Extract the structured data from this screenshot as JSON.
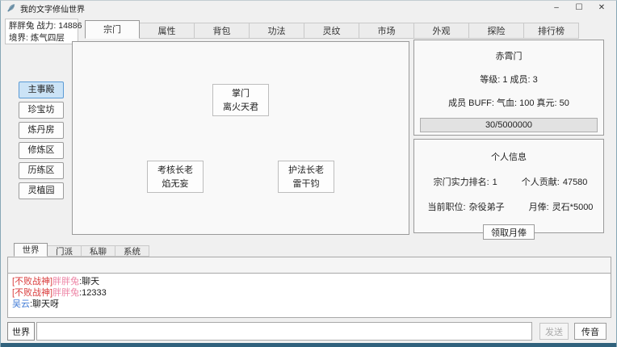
{
  "window": {
    "title": "我的文字修仙世界",
    "controls": {
      "minimize": "–",
      "maximize": "☐",
      "close": "✕"
    }
  },
  "player": {
    "line1": "胖胖兔 战力: 14886",
    "line2": "境界: 炼气四层"
  },
  "tabs": {
    "items": [
      "宗门",
      "属性",
      "背包",
      "功法",
      "灵纹",
      "市场",
      "外观",
      "探险",
      "排行榜"
    ],
    "active": "宗门"
  },
  "sidebar": {
    "items": [
      "主事殿",
      "珍宝坊",
      "炼丹房",
      "修炼区",
      "历练区",
      "灵植园"
    ],
    "active": "主事殿"
  },
  "sect_map": {
    "nodes": [
      {
        "title": "掌门",
        "name": "离火天君"
      },
      {
        "title": "考核长老",
        "name": "焰无妄"
      },
      {
        "title": "护法长老",
        "name": "雷干钧"
      }
    ]
  },
  "sect_panel": {
    "name": "赤霄门",
    "level_members": "等级: 1 成员: 3",
    "buff": "成员 BUFF:  气血: 100 真元: 50",
    "progress_text": "30/5000000"
  },
  "personal_panel": {
    "title": "个人信息",
    "rank_label": "宗门实力排名:",
    "rank_value": "1",
    "contrib_label": "个人贡献:",
    "contrib_value": "47580",
    "position_label": "当前职位:",
    "position_value": "杂役弟子",
    "salary_label": "月俸:",
    "salary_value": "灵石*5000",
    "claim_button": "领取月俸"
  },
  "chat": {
    "tabs": [
      "世界",
      "门派",
      "私聊",
      "系统"
    ],
    "active_tab": "世界",
    "messages": [
      {
        "prefix": "[不败战神]",
        "prefix_color": "#d93a3a",
        "name": "胖胖兔",
        "name_color": "#ed84a5",
        "text": ":聊天",
        "text_color": "#1a1a1a"
      },
      {
        "prefix": "[不败战神]",
        "prefix_color": "#d93a3a",
        "name": "胖胖兔",
        "name_color": "#ed84a5",
        "text": ":12333",
        "text_color": "#1a1a1a"
      },
      {
        "prefix": "",
        "prefix_color": "#d93a3a",
        "name": "吴云",
        "name_color": "#3f7ad6",
        "text": ":聊天呀",
        "text_color": "#1a1a1a"
      }
    ],
    "channel_button": "世界",
    "input_value": "",
    "send_button": "发送",
    "voice_button": "传音"
  },
  "colors": {
    "window_bg": "#f0f0f0",
    "panel_bg": "#f9f9f9",
    "active_sidebar_bg": "#cbe3f6",
    "active_sidebar_border": "#5b9bd5",
    "bottom_edge": "#30617c",
    "chat_red": "#d93a3a",
    "chat_pink": "#ed84a5",
    "chat_blue": "#3f7ad6",
    "disabled_text": "#a9a9a9"
  }
}
